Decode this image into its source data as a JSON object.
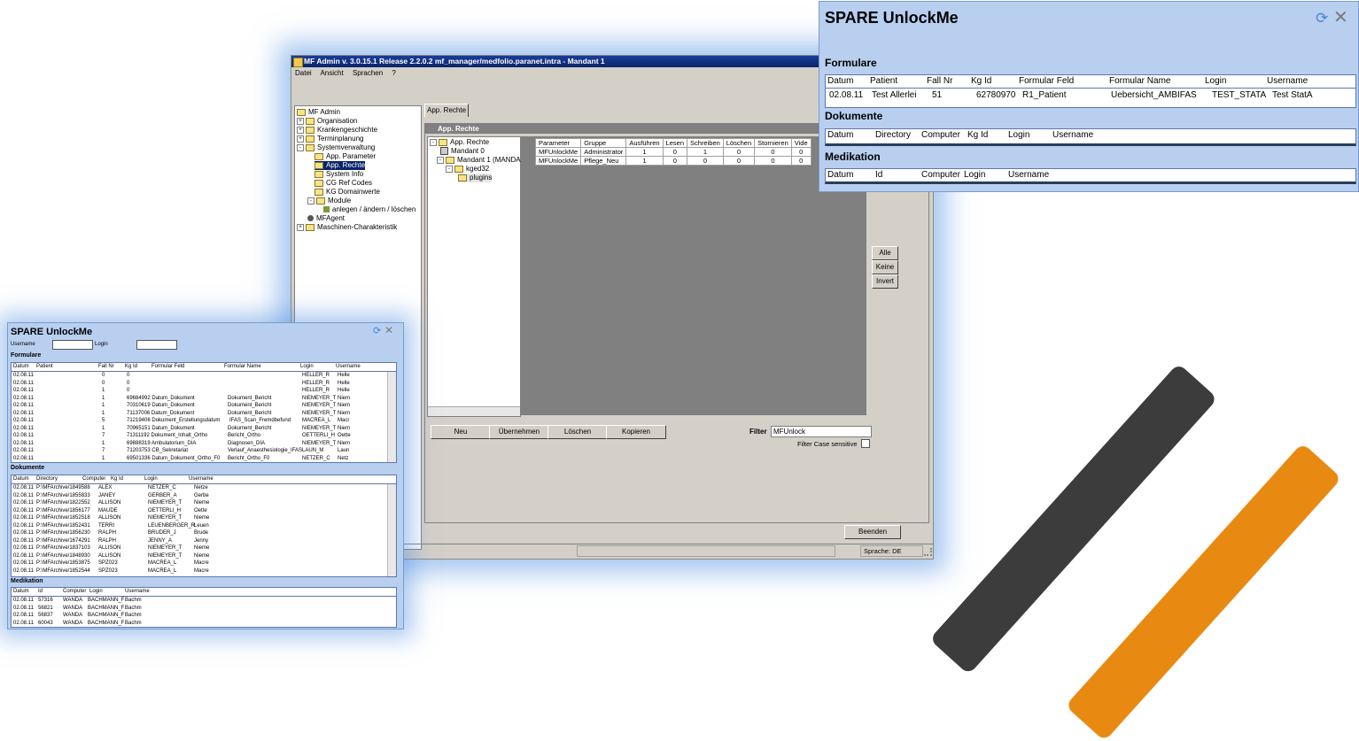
{
  "admin_window": {
    "title": "MF Admin v. 3.0.15.1 Release 2.2.0.2 mf_manager/medfolio.paranet.intra - Mandant 1",
    "menu": [
      "Datei",
      "Ansicht",
      "Sprachen",
      "?"
    ],
    "nav_tree": [
      "MF Admin",
      "Organisation",
      "Krankengeschichte",
      "Terminplanung",
      "Systemverwaltung",
      "App. Parameter",
      "App. Rechte",
      "System Info",
      "CG Ref Codes",
      "KG Domainwerte",
      "Module",
      "anlegen / ändern / löschen",
      "MFAgent",
      "Maschinen-Charakteristik"
    ],
    "tab": "App. Rechte",
    "subpanel_title": "App. Rechte",
    "rights_tree": [
      "App. Rechte",
      "Mandant 0",
      "Mandant 1 (MANDAN",
      "kged32",
      "plugins"
    ],
    "grid_columns": [
      "Parameter",
      "Gruppe",
      "Ausführen",
      "Lesen",
      "Schreiben",
      "Löschen",
      "Stornieren",
      "Vide"
    ],
    "grid_rows": [
      [
        "MFUnlockMe",
        "Administrator",
        "1",
        "0",
        "1",
        "0",
        "0",
        "0"
      ],
      [
        "MFUnlockMe",
        "Pflege_Neu",
        "1",
        "0",
        "0",
        "0",
        "0",
        "0"
      ]
    ],
    "side_buttons": [
      "Alle",
      "Keine",
      "Invert"
    ],
    "buttons": {
      "neu": "Neu",
      "uebernehmen": "Übernehmen",
      "loeschen": "Löschen",
      "kopieren": "Kopieren"
    },
    "filter_label": "Filter",
    "filter_value": "MFUnlock",
    "case_label": "Filter Case sensitive",
    "beenden": "Beenden",
    "status_lang": "Sprache: DE"
  },
  "unlock_large": {
    "title": "SPARE UnlockMe",
    "formulare": {
      "label": "Formulare",
      "headers": [
        "Datum",
        "Patient",
        "Fall Nr",
        "Kg Id",
        "Formular Feld",
        "Formular Name",
        "Login",
        "Username"
      ],
      "row": [
        "02.08.11",
        "Test Allerlei",
        "51",
        "62780970",
        "R1_Patient",
        "Uebersicht_AMBIFAS",
        "TEST_STATA",
        "Test StatA"
      ]
    },
    "dokumente": {
      "label": "Dokumente",
      "headers": [
        "Datum",
        "Directory",
        "Computer",
        "Kg Id",
        "Login",
        "Username"
      ]
    },
    "medikation": {
      "label": "Medikation",
      "headers": [
        "Datum",
        "Id",
        "Computer",
        "Login",
        "Username"
      ]
    }
  },
  "unlock_small": {
    "title": "SPARE UnlockMe",
    "username_label": "Username",
    "login_label": "Login",
    "formulare": {
      "label": "Formulare",
      "headers": [
        "Datum",
        "Patient",
        "Fall Nr",
        "Kg Id",
        "Formular Feld",
        "Formular Name",
        "Login",
        "Username"
      ],
      "rows": [
        [
          "02.08.11",
          "0",
          "0",
          "",
          "",
          "HELLER_R",
          "Helle"
        ],
        [
          "02.08.11",
          "0",
          "0",
          "",
          "",
          "HELLER_R",
          "Helle"
        ],
        [
          "02.08.11",
          "1",
          "0",
          "",
          "",
          "HELLER_R",
          "Helle"
        ],
        [
          "02.08.11",
          "1",
          "69684992 Datum_Dokument",
          "",
          "Dokument_Bericht",
          "NIEMEYER_T",
          "Niem"
        ],
        [
          "02.08.11",
          "1",
          "70310619 Datum_Dokument",
          "",
          "Dokument_Bericht",
          "NIEMEYER_T",
          "Niem"
        ],
        [
          "02.08.11",
          "1",
          "71137006 Datum_Dokument",
          "",
          "Dokument_Bericht",
          "NIEMEYER_T",
          "Niem"
        ],
        [
          "02.08.11",
          "5",
          "71219406 Dokument_Erstellungsdatum",
          "",
          "IFAS_Scan_Fremdbefund",
          "MACREA_L",
          "Macr"
        ],
        [
          "02.08.11",
          "1",
          "70965151 Datum_Dokument",
          "",
          "Dokument_Bericht",
          "NIEMEYER_T",
          "Niem"
        ],
        [
          "02.08.11",
          "7",
          "71311192 Dokument_Inhalt_Ortho",
          "",
          "Bericht_Ortho",
          "OETTERLI_H",
          "Oette"
        ],
        [
          "02.08.11",
          "1",
          "69888319 Ambulatorium_DIA",
          "",
          "Diagnosen_DIA",
          "NIEMEYER_T",
          "Niem"
        ],
        [
          "02.08.11",
          "7",
          "71203753 CB_Sekretariat",
          "",
          "Verlauf_Anaesthesiologie_IFAS",
          "LAUN_M",
          "Laun"
        ],
        [
          "02.08.11",
          "1",
          "69501336 Datum_Dokument_Ortho_F0",
          "",
          "Bericht_Ortho_F0",
          "NETZER_C",
          "Netz"
        ]
      ]
    },
    "dokumente": {
      "label": "Dokumente",
      "headers": [
        "Datum",
        "Directory",
        "Computer",
        "Kg Id",
        "Login",
        "Username"
      ],
      "rows": [
        [
          "02.08.11",
          "P:\\MFArchive/1849588",
          "ALEX",
          "NETZER_C",
          "Netze"
        ],
        [
          "02.08.11",
          "P:\\MFArchive/1855833",
          "JANEY",
          "GERBER_A",
          "Gerbe"
        ],
        [
          "02.08.11",
          "P:\\MFArchive/1822552",
          "ALLISON",
          "NIEMEYER_T",
          "Nieme"
        ],
        [
          "02.08.11",
          "P:\\MFArchive/1856177",
          "MAUDE",
          "OETTERLI_H",
          "Oette"
        ],
        [
          "02.08.11",
          "P:\\MFArchive/1852518",
          "ALLISON",
          "NIEMEYER_T",
          "Nieme"
        ],
        [
          "02.08.11",
          "P:\\MFArchive/1852431",
          "TERRI",
          "LEUENBERGER_R",
          "Leuen"
        ],
        [
          "02.08.11",
          "P:\\MFArchive/1856230",
          "RALPH",
          "BRUDER_J",
          "Brude"
        ],
        [
          "02.08.11",
          "P:\\MFArchive/1674291",
          "RALPH",
          "JENNY_A",
          "Jenny"
        ],
        [
          "02.08.11",
          "P:\\MFArchive/1837103",
          "ALLISON",
          "NIEMEYER_T",
          "Nieme"
        ],
        [
          "02.08.11",
          "P:\\MFArchive/1848930",
          "ALLISON",
          "NIEMEYER_T",
          "Nieme"
        ],
        [
          "02.08.11",
          "P:\\MFArchive/1853875",
          "SPZ023",
          "MACREA_L",
          "Macre"
        ],
        [
          "02.08.11",
          "P:\\MFArchive/1852544",
          "SPZ023",
          "MACREA_L",
          "Macre"
        ]
      ]
    },
    "medikation": {
      "label": "Medikation",
      "headers": [
        "Datum",
        "Id",
        "Computer",
        "Login",
        "Username"
      ],
      "rows": [
        [
          "02.08.11",
          "57316",
          "WANDA",
          "BACHMANN_F",
          "Bachm"
        ],
        [
          "02.08.11",
          "56821",
          "WANDA",
          "BACHMANN_F",
          "Bachm"
        ],
        [
          "02.08.11",
          "56837",
          "WANDA",
          "BACHMANN_F",
          "Bachm"
        ],
        [
          "02.08.11",
          "60043",
          "WANDA",
          "BACHMANN_F",
          "Bachm"
        ]
      ]
    }
  },
  "colors": {
    "panel_bg": "#b8cff0",
    "titlebar": "#0a246a",
    "accent_orange": "#e88a12",
    "deco_dark": "#3c3c3c"
  }
}
